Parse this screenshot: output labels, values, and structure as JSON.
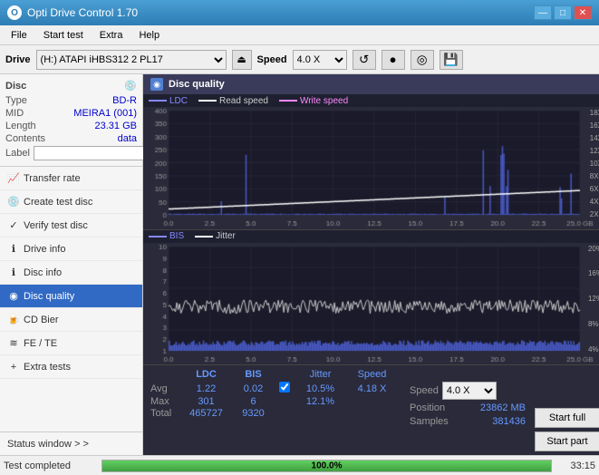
{
  "titleBar": {
    "title": "Opti Drive Control 1.70",
    "icon": "O",
    "minimize": "—",
    "maximize": "□",
    "close": "✕"
  },
  "menuBar": {
    "items": [
      "File",
      "Start test",
      "Extra",
      "Help"
    ]
  },
  "driveBar": {
    "drive_label": "Drive",
    "drive_value": "(H:) ATAPI iHBS312  2 PL17",
    "speed_label": "Speed",
    "speed_value": "4.0 X"
  },
  "sidebar": {
    "disc_section_title": "Disc",
    "disc_info": {
      "type_label": "Type",
      "type_value": "BD-R",
      "mid_label": "MID",
      "mid_value": "MEIRA1 (001)",
      "length_label": "Length",
      "length_value": "23.31 GB",
      "contents_label": "Contents",
      "contents_value": "data",
      "label_label": "Label"
    },
    "nav_items": [
      {
        "id": "transfer-rate",
        "label": "Transfer rate",
        "active": false
      },
      {
        "id": "create-test-disc",
        "label": "Create test disc",
        "active": false
      },
      {
        "id": "verify-test-disc",
        "label": "Verify test disc",
        "active": false
      },
      {
        "id": "drive-info",
        "label": "Drive info",
        "active": false
      },
      {
        "id": "disc-info",
        "label": "Disc info",
        "active": false
      },
      {
        "id": "disc-quality",
        "label": "Disc quality",
        "active": true
      },
      {
        "id": "cd-bier",
        "label": "CD Bier",
        "active": false
      },
      {
        "id": "fe-te",
        "label": "FE / TE",
        "active": false
      },
      {
        "id": "extra-tests",
        "label": "Extra tests",
        "active": false
      }
    ],
    "status_window": "Status window > >"
  },
  "discQuality": {
    "title": "Disc quality",
    "legend_top": [
      {
        "label": "LDC",
        "color": "#8888ff"
      },
      {
        "label": "Read speed",
        "color": "#ffffff"
      },
      {
        "label": "Write speed",
        "color": "#ff88ff"
      }
    ],
    "legend_bottom": [
      {
        "label": "BIS",
        "color": "#8888ff"
      },
      {
        "label": "Jitter",
        "color": "#ffffff"
      }
    ],
    "y_axis_top_right": [
      "18X",
      "16X",
      "14X",
      "12X",
      "10X",
      "8X",
      "6X",
      "4X",
      "2X"
    ],
    "y_axis_top_left": [
      "400",
      "350",
      "300",
      "250",
      "200",
      "150",
      "100",
      "50",
      "0"
    ],
    "y_axis_bottom_right": [
      "20%",
      "16%",
      "12%",
      "8%",
      "4%"
    ],
    "y_axis_bottom_left": [
      "10",
      "9",
      "8",
      "7",
      "6",
      "5",
      "4",
      "3",
      "2",
      "1"
    ],
    "x_axis": [
      "0.0",
      "2.5",
      "5.0",
      "7.5",
      "10.0",
      "12.5",
      "15.0",
      "17.5",
      "20.0",
      "22.5",
      "25.0 GB"
    ],
    "stats": {
      "columns": [
        "LDC",
        "BIS",
        "",
        "Jitter",
        "Speed"
      ],
      "avg_label": "Avg",
      "avg_ldc": "1.22",
      "avg_bis": "0.02",
      "avg_jitter": "10.5%",
      "avg_speed": "4.18 X",
      "max_label": "Max",
      "max_ldc": "301",
      "max_bis": "6",
      "max_jitter": "12.1%",
      "total_label": "Total",
      "total_ldc": "465727",
      "total_bis": "9320",
      "position_label": "Position",
      "position_value": "23862 MB",
      "samples_label": "Samples",
      "samples_value": "381436",
      "speed_select": "4.0 X",
      "jitter_checked": true,
      "jitter_label": "Jitter"
    },
    "buttons": {
      "start_full": "Start full",
      "start_part": "Start part"
    }
  },
  "bottomBar": {
    "status": "Test completed",
    "progress": "100.0%",
    "progress_value": 100,
    "time": "33:15"
  }
}
